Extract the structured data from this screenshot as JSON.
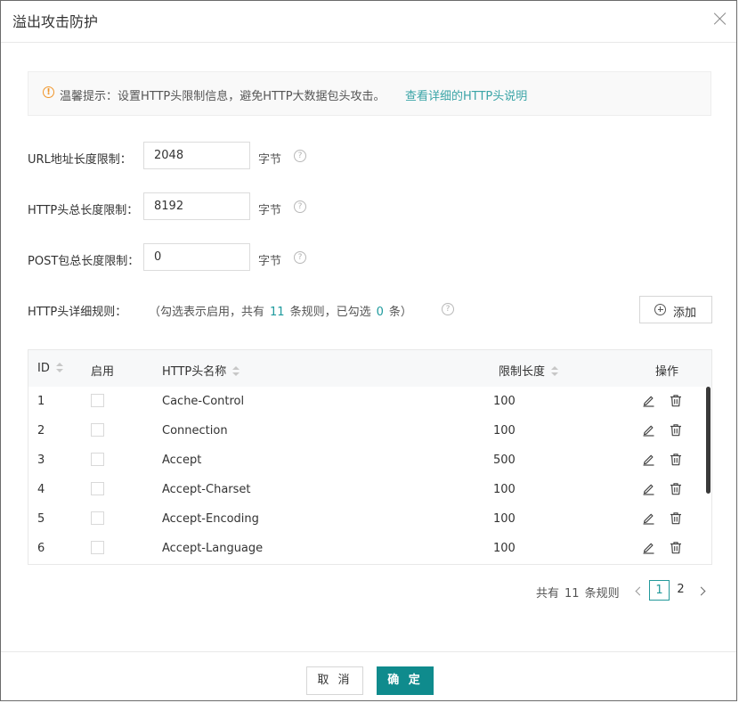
{
  "dialog": {
    "title": "溢出攻击防护",
    "close_icon": "close-icon"
  },
  "tip": {
    "icon": "warning-icon",
    "icon_glyph": "!",
    "text": "温馨提示：设置HTTP头限制信息，避免HTTP大数据包头攻击。",
    "link": "查看详细的HTTP头说明"
  },
  "form": {
    "url_limit": {
      "label": "URL地址长度限制：",
      "value": "2048",
      "unit": "字节"
    },
    "header_limit": {
      "label": "HTTP头总长度限制：",
      "value": "8192",
      "unit": "字节"
    },
    "post_limit": {
      "label": "POST包总长度限制：",
      "value": "0",
      "unit": "字节"
    },
    "help_glyph": "?"
  },
  "rules": {
    "label": "HTTP头详细规则：",
    "note_prefix": "（勾选表示启用，共有",
    "total": "11",
    "note_mid": "条规则，已勾选",
    "checked": "0",
    "note_suffix": "条）",
    "add_label": "添加"
  },
  "table": {
    "columns": {
      "id": "ID",
      "enabled": "启用",
      "name": "HTTP头名称",
      "limit": "限制长度",
      "actions": "操作"
    },
    "rows": [
      {
        "id": "1",
        "name": "Cache-Control",
        "limit": "100",
        "enabled": false
      },
      {
        "id": "2",
        "name": "Connection",
        "limit": "100",
        "enabled": false
      },
      {
        "id": "3",
        "name": "Accept",
        "limit": "500",
        "enabled": false
      },
      {
        "id": "4",
        "name": "Accept-Charset",
        "limit": "100",
        "enabled": false
      },
      {
        "id": "5",
        "name": "Accept-Encoding",
        "limit": "100",
        "enabled": false
      },
      {
        "id": "6",
        "name": "Accept-Language",
        "limit": "100",
        "enabled": false
      }
    ]
  },
  "pagination": {
    "total_prefix": "共有",
    "total": "11",
    "total_suffix": "条规则",
    "pages": [
      "1",
      "2"
    ],
    "current": "1"
  },
  "footer": {
    "cancel": "取 消",
    "ok": "确 定"
  },
  "colors": {
    "accent": "#0f8b8d",
    "link": "#3aa4a6",
    "warning": "#f0952a"
  }
}
